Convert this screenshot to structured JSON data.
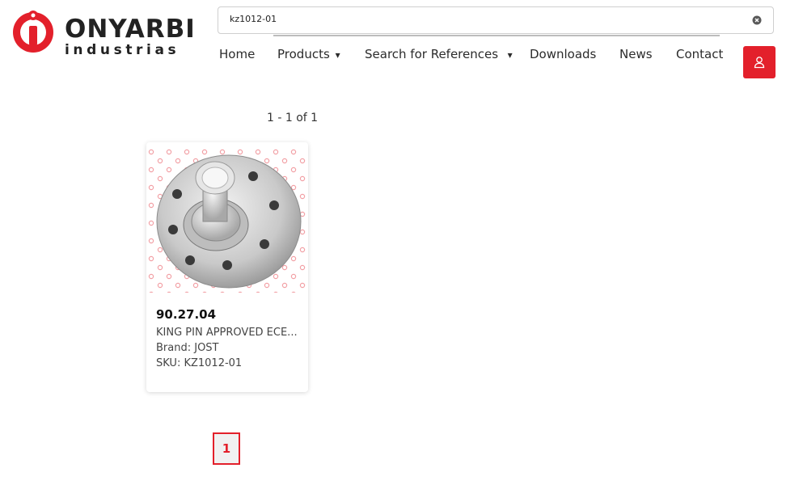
{
  "header": {
    "logo": {
      "name": "ONYARBI",
      "sub": "industrias",
      "icon": "onyarbi-logo-icon"
    },
    "search": {
      "value": "kz1012-01",
      "placeholder": "",
      "clear_icon": "clear-circle-icon"
    },
    "nav": [
      {
        "label": "Home"
      },
      {
        "label": "Products",
        "caret": "▾"
      },
      {
        "label": "Search for References",
        "caret": "▾"
      },
      {
        "label": "Downloads"
      },
      {
        "label": "News"
      },
      {
        "label": "Contact"
      }
    ],
    "user_icon": "user-icon"
  },
  "results": {
    "count_text": "1 - 1 of 1",
    "items": [
      {
        "code": "90.27.04",
        "description": "KING PIN APPROVED ECE...",
        "brand": "Brand: JOST",
        "sku": "SKU: KZ1012-01",
        "image_icon": "king-pin-product-image"
      }
    ]
  },
  "pagination": {
    "pages": [
      "1"
    ],
    "current": "1"
  },
  "colors": {
    "brand_red": "#e3202b",
    "text": "#2b2b2b"
  }
}
